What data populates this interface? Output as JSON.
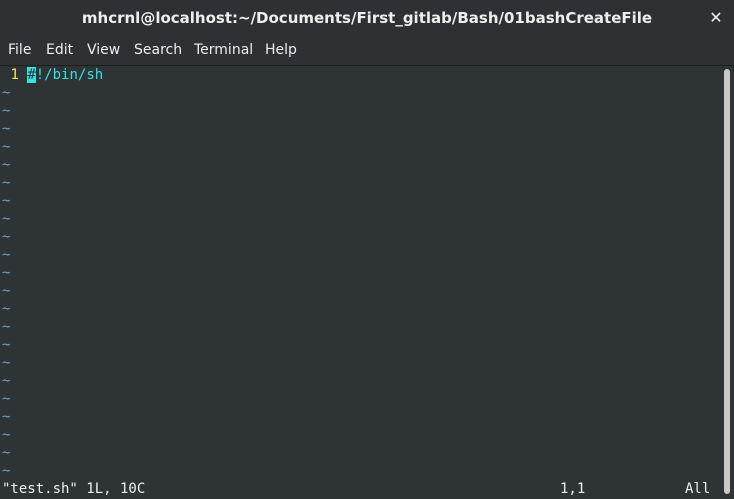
{
  "window": {
    "title": "mhcrnl@localhost:~/Documents/First_gitlab/Bash/01bashCreateFile",
    "close_glyph": "✕",
    "close_icon": "close-icon"
  },
  "menu": {
    "file": "File",
    "edit": "Edit",
    "view": "View",
    "search": "Search",
    "terminal": "Terminal",
    "help": "Help"
  },
  "editor": {
    "line_number": "1",
    "cursor_char": "#",
    "code_rest": "!/bin/sh",
    "empty_marker": "~",
    "status_file": "\"test.sh\" 1L, 10C",
    "status_position": "1,1",
    "status_scroll": "All"
  },
  "colors": {
    "background": "#2e3436",
    "line_number": "#fce94f",
    "code": "#34e2e2",
    "tilde": "#729fcf"
  }
}
